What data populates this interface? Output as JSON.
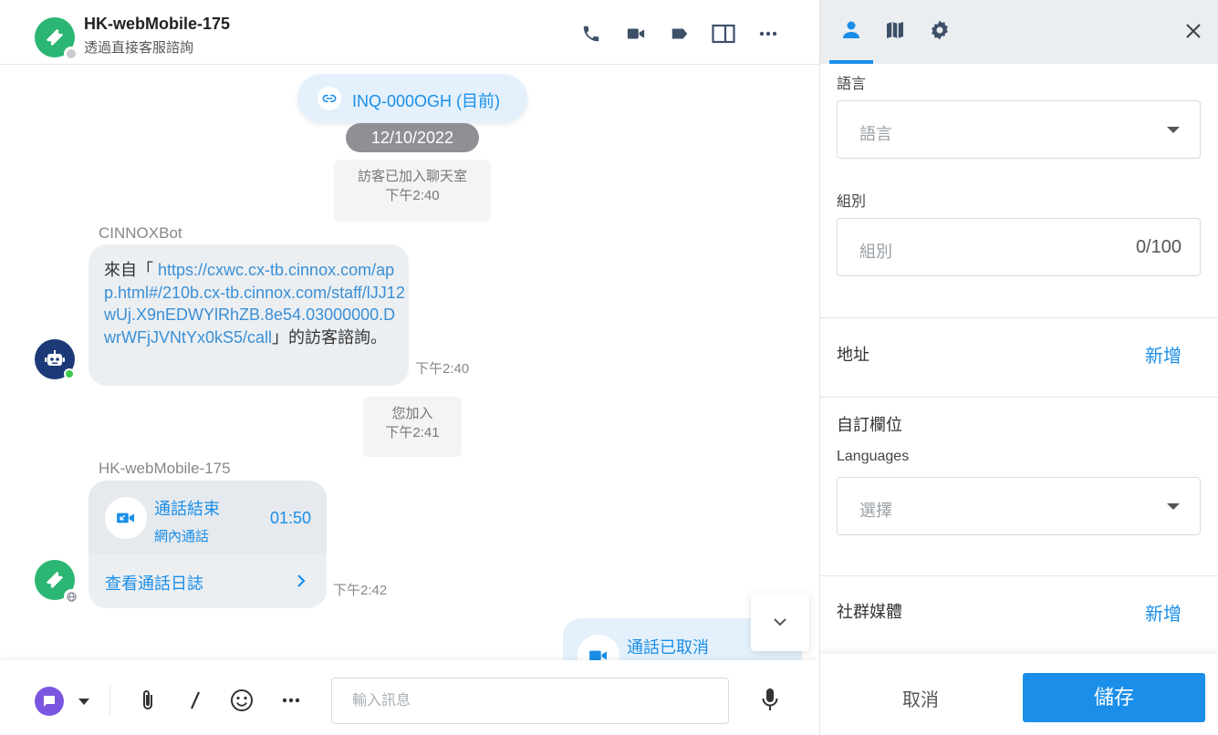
{
  "header": {
    "title": "HK-webMobile-175",
    "subtitle": "透過直接客服諮詢",
    "icons": [
      "phone-icon",
      "video-icon",
      "tag-icon",
      "panel-icon",
      "more-icon"
    ]
  },
  "conversation": {
    "inquiry_label": "INQ-000OGH (目前)",
    "date": "12/10/2022",
    "system_joined": {
      "text": "訪客已加入聊天室",
      "time": "下午2:40"
    },
    "bot": {
      "name": "CINNOXBot",
      "prefix": "來自「 ",
      "link": "https://cxwc.cx-tb.cinnox.com/app.html#/210b.cx-tb.cinnox.com/staff/lJJ12wUj.X9nEDWYlRhZB.8e54.03000000.DwrWFjJVNtYx0kS5/call",
      "suffix": "」的訪客諮詢。",
      "time": "下午2:40"
    },
    "you_joined": {
      "text": "您加入",
      "time": "下午2:41"
    },
    "visitor": {
      "name": "HK-webMobile-175",
      "call_title": "通話結束",
      "call_type": "網內通話",
      "duration": "01:50",
      "view_log": "查看通話日誌",
      "time": "下午2:42"
    },
    "cancelled_call": {
      "title": "通話已取消"
    }
  },
  "composer": {
    "placeholder": "輸入訊息"
  },
  "side_panel": {
    "tabs": [
      "profile",
      "map",
      "settings"
    ],
    "language_label": "語言",
    "language_placeholder": "語言",
    "group_label": "組別",
    "group_placeholder": "組別",
    "group_count": "0/100",
    "address_label": "地址",
    "address_add": "新增",
    "custom_fields_label": "自訂欄位",
    "languages_label": "Languages",
    "languages_placeholder": "選擇",
    "social_label": "社群媒體",
    "social_add": "新增",
    "cancel": "取消",
    "save": "儲存"
  },
  "colors": {
    "accent": "#1a8ee8",
    "visitor_avatar": "#2bb673",
    "bot_avatar": "#1d3a78",
    "composer_button": "#7b55e0"
  }
}
